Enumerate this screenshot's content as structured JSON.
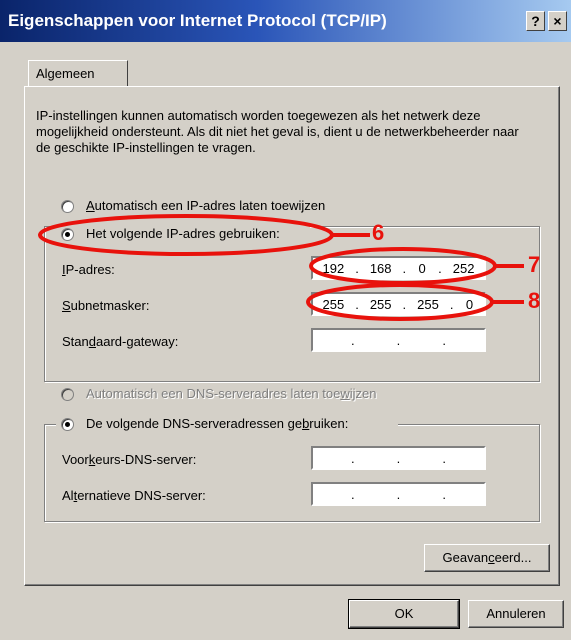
{
  "window": {
    "title": "Eigenschappen voor Internet Protocol (TCP/IP)",
    "help_button": "?",
    "close_button": "×"
  },
  "tabs": [
    {
      "label": "Algemeen"
    }
  ],
  "intro_text": "IP-instellingen kunnen automatisch worden toegewezen als het netwerk deze mogelijkheid ondersteunt. Als dit niet het geval is, dient u de netwerkbeheerder naar de geschikte IP-instellingen te vragen.",
  "ip_section": {
    "auto_radio": {
      "pre": "",
      "ul": "A",
      "post": "utomatisch een IP-adres laten toewijzen",
      "checked": false
    },
    "manual_radio": {
      "pre": "Het vol",
      "ul": "g",
      "post": "ende IP-adres gebruiken:",
      "checked": true
    },
    "fields": [
      {
        "pre": "",
        "ul": "I",
        "post": "P-adres:",
        "octets": [
          "192",
          "168",
          "0",
          "252"
        ]
      },
      {
        "pre": "",
        "ul": "S",
        "post": "ubnetmasker:",
        "octets": [
          "255",
          "255",
          "255",
          "0"
        ]
      },
      {
        "pre": "Stan",
        "ul": "d",
        "post": "aard-gateway:",
        "octets": [
          "",
          "",
          "",
          ""
        ]
      }
    ]
  },
  "dns_section": {
    "auto_radio": {
      "pre": "Automatisch een DNS-serveradres laten toe",
      "ul": "w",
      "post": "ijzen",
      "checked": false,
      "disabled": true
    },
    "manual_radio": {
      "pre": "De volgende DNS-serveradressen ge",
      "ul": "b",
      "post": "ruiken:",
      "checked": true
    },
    "fields": [
      {
        "pre": "Voor",
        "ul": "k",
        "post": "eurs-DNS-server:",
        "octets": [
          "",
          "",
          "",
          ""
        ]
      },
      {
        "pre": "Al",
        "ul": "t",
        "post": "ernatieve DNS-server:",
        "octets": [
          "",
          "",
          "",
          ""
        ]
      }
    ]
  },
  "buttons": {
    "advanced": {
      "pre": "Geavan",
      "ul": "c",
      "post": "eerd..."
    },
    "ok": "OK",
    "cancel": "Annuleren"
  },
  "callouts": [
    "6",
    "7",
    "8"
  ],
  "colors": {
    "callout": "#e8120c",
    "title_bar_start": "#0a246a",
    "title_bar_end": "#a6caf0"
  }
}
